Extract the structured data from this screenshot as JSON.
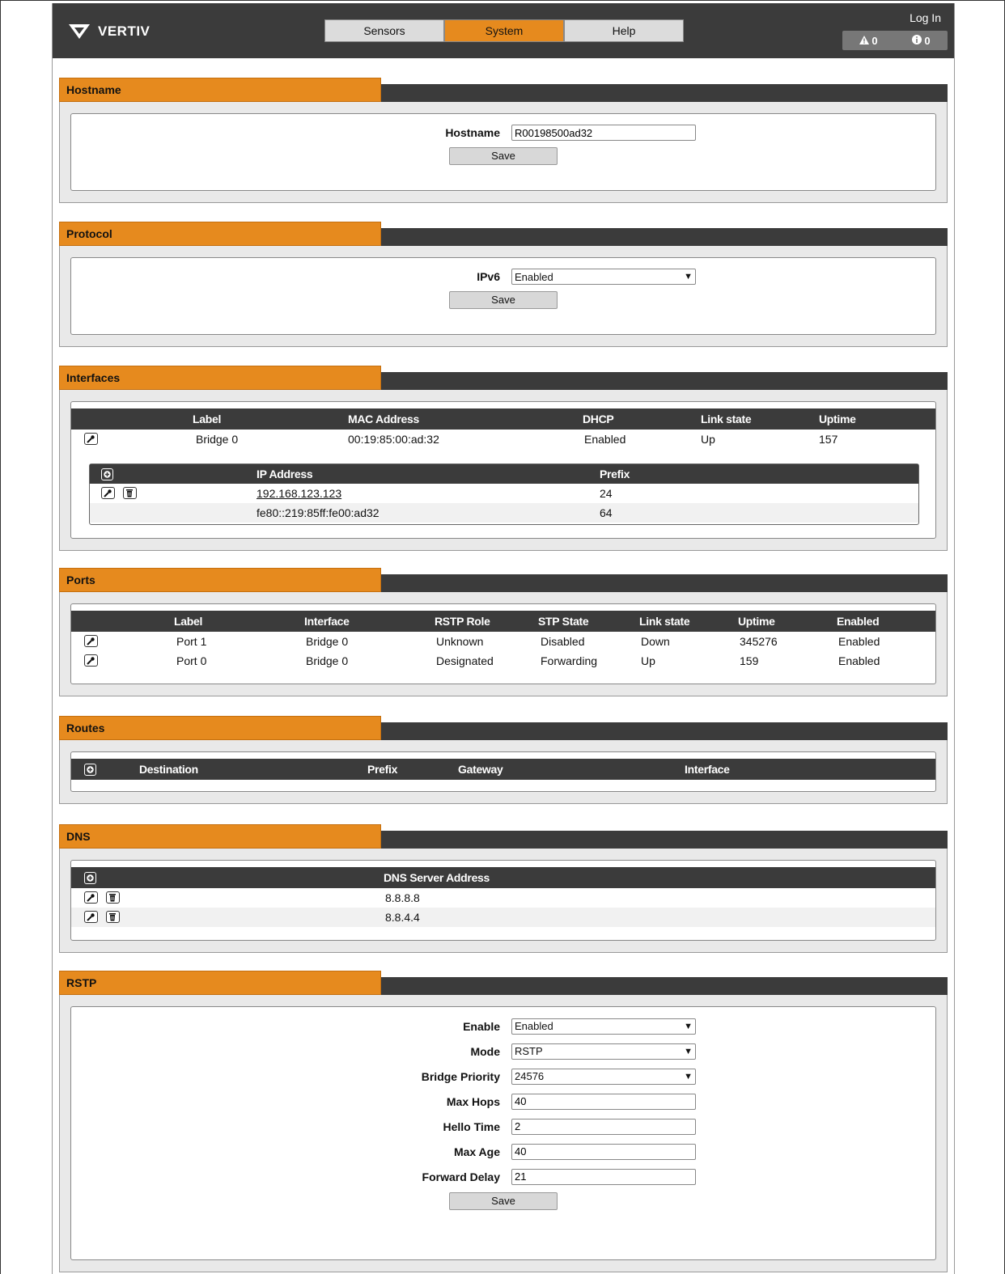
{
  "header": {
    "brand": "VERTIV",
    "tabs": [
      "Sensors",
      "System",
      "Help"
    ],
    "active_tab": "System",
    "login_label": "Log In",
    "alarm_count": "0",
    "warning_count": "0",
    "accent_color": "#e68a1e",
    "dark_color": "#3b3b3b"
  },
  "hostname": {
    "title": "Hostname",
    "label": "Hostname",
    "value": "R00198500ad32",
    "save_label": "Save"
  },
  "protocol": {
    "title": "Protocol",
    "label": "IPv6",
    "value": "Enabled",
    "save_label": "Save"
  },
  "interfaces": {
    "title": "Interfaces",
    "columns": [
      "Label",
      "MAC Address",
      "DHCP",
      "Link state",
      "Uptime"
    ],
    "rows": [
      {
        "label": "Bridge 0",
        "mac": "00:19:85:00:ad:32",
        "dhcp": "Enabled",
        "link": "Up",
        "uptime": "157"
      }
    ],
    "ip_columns": [
      "IP Address",
      "Prefix"
    ],
    "ip_rows": [
      {
        "ip": "192.168.123.123",
        "prefix": "24"
      },
      {
        "ip": "fe80::219:85ff:fe00:ad32",
        "prefix": "64"
      }
    ]
  },
  "ports": {
    "title": "Ports",
    "columns": [
      "Label",
      "Interface",
      "RSTP Role",
      "STP State",
      "Link state",
      "Uptime",
      "Enabled"
    ],
    "rows": [
      {
        "label": "Port 1",
        "interface": "Bridge 0",
        "role": "Unknown",
        "state": "Disabled",
        "link": "Down",
        "uptime": "345276",
        "enabled": "Enabled"
      },
      {
        "label": "Port 0",
        "interface": "Bridge 0",
        "role": "Designated",
        "state": "Forwarding",
        "link": "Up",
        "uptime": "159",
        "enabled": "Enabled"
      }
    ]
  },
  "routes": {
    "title": "Routes",
    "columns": [
      "Destination",
      "Prefix",
      "Gateway",
      "Interface"
    ]
  },
  "dns": {
    "title": "DNS",
    "column": "DNS Server Address",
    "rows": [
      "8.8.8.8",
      "8.8.4.4"
    ]
  },
  "rstp": {
    "title": "RSTP",
    "enable_label": "Enable",
    "enable_value": "Enabled",
    "mode_label": "Mode",
    "mode_value": "RSTP",
    "priority_label": "Bridge Priority",
    "priority_value": "24576",
    "max_hops_label": "Max Hops",
    "max_hops_value": "40",
    "hello_label": "Hello Time",
    "hello_value": "2",
    "max_age_label": "Max Age",
    "max_age_value": "40",
    "fwd_delay_label": "Forward Delay",
    "fwd_delay_value": "21",
    "save_label": "Save"
  }
}
